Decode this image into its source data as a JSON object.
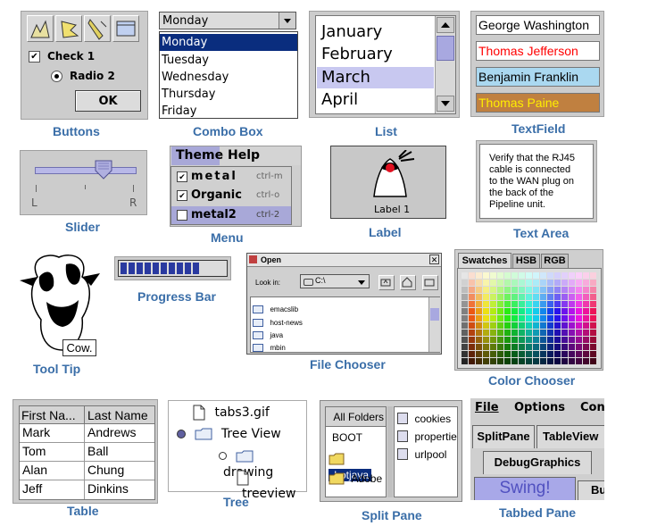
{
  "buttons": {
    "check1": "Check 1",
    "radio2": "Radio 2",
    "ok": "OK",
    "caption": "Buttons"
  },
  "combo": {
    "selected": "Monday",
    "options": [
      "Monday",
      "Tuesday",
      "Wednesday",
      "Thursday",
      "Friday"
    ],
    "caption": "Combo Box"
  },
  "list": {
    "items": [
      "January",
      "February",
      "March",
      "April"
    ],
    "selected_index": 2,
    "caption": "List"
  },
  "textfield": {
    "fields": [
      "George Washington",
      "Thomas Jefferson",
      "Benjamin Franklin",
      "Thomas Paine"
    ],
    "caption": "TextField",
    "colors": {
      "jefferson_text": "#ff0000",
      "franklin_bg": "#aad8f0",
      "paine_bg": "#c08040",
      "paine_text": "#ffee00"
    }
  },
  "slider": {
    "min_label": "L",
    "max_label": "R",
    "value_fraction": 0.62,
    "caption": "Slider"
  },
  "menu": {
    "bar": [
      "Theme",
      "Help"
    ],
    "items": [
      {
        "label": "metal",
        "shortcut": "ctrl-m",
        "checked": true
      },
      {
        "label": "Organic",
        "shortcut": "ctrl-o",
        "checked": true
      },
      {
        "label": "metal2",
        "shortcut": "ctrl-2",
        "checked": false
      }
    ],
    "caption": "Menu"
  },
  "label": {
    "text": "Label 1",
    "caption": "Label"
  },
  "textarea": {
    "lines": [
      "Verify that the RJ45",
      "cable is connected",
      "to the WAN plug on",
      "the back of the",
      "Pipeline unit."
    ],
    "caption": "Text Area"
  },
  "tooltip": {
    "text": "Cow.",
    "caption": "Tool Tip"
  },
  "progress": {
    "value_fraction": 0.77,
    "caption": "Progress Bar"
  },
  "filechooser": {
    "title": "Open",
    "look_in_label": "Look in:",
    "look_in_value": "C:\\",
    "files": [
      "emacslib",
      "host-news",
      "java",
      "mbin"
    ],
    "caption": "File Chooser"
  },
  "colorchooser": {
    "tabs": [
      "Swatches",
      "HSB",
      "RGB"
    ],
    "caption": "Color Chooser"
  },
  "table": {
    "headers": [
      "First Na...",
      "Last Name"
    ],
    "rows": [
      [
        "Mark",
        "Andrews"
      ],
      [
        "Tom",
        "Ball"
      ],
      [
        "Alan",
        "Chung"
      ],
      [
        "Jeff",
        "Dinkins"
      ]
    ],
    "caption": "Table"
  },
  "tree": {
    "nodes": [
      "tabs3.gif",
      "Tree View",
      "drawing",
      "treeview"
    ],
    "caption": "Tree"
  },
  "splitpane": {
    "left_header": "All Folders",
    "left_items": [
      "BOOT",
      ".hotjava",
      "Adobe"
    ],
    "right_items": [
      "cookies",
      "propertie",
      "urlpool"
    ],
    "caption": "Split Pane"
  },
  "tabbedpane": {
    "menubar": [
      "File",
      "Options",
      "Con"
    ],
    "tabs_row1": [
      "SplitPane",
      "TableView"
    ],
    "tabs_row2": [
      "DebugGraphics"
    ],
    "tabs_row3": [
      "Swing!",
      "Bu"
    ],
    "caption": "Tabbed Pane"
  }
}
